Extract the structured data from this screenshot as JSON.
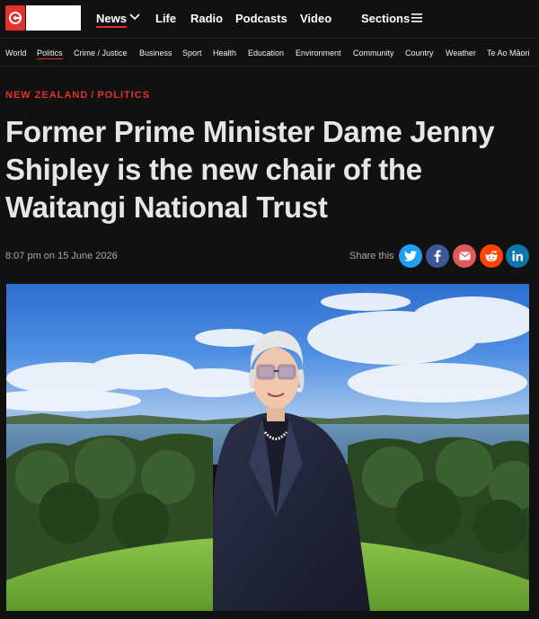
{
  "header": {
    "nav": [
      {
        "label": "News"
      },
      {
        "label": "Life"
      },
      {
        "label": "Radio"
      },
      {
        "label": "Podcasts"
      },
      {
        "label": "Video"
      }
    ],
    "sections_label": "Sections"
  },
  "subnav": {
    "items": [
      {
        "label": "World"
      },
      {
        "label": "Politics"
      },
      {
        "label": "Crime / Justice"
      },
      {
        "label": "Business"
      },
      {
        "label": "Sport"
      },
      {
        "label": "Health"
      },
      {
        "label": "Education"
      },
      {
        "label": "Environment"
      },
      {
        "label": "Community"
      },
      {
        "label": "Country"
      },
      {
        "label": "Weather"
      },
      {
        "label": "Te Ao Māori"
      }
    ],
    "active": "Politics"
  },
  "article": {
    "kicker_primary": "NEW ZEALAND",
    "kicker_separator": "/",
    "kicker_secondary": "POLITICS",
    "headline": "Former Prime Minister Dame Jenny Shipley is the new chair of the Waitangi National Trust",
    "timestamp": "8:07 pm on 15 June 2026",
    "share_label": "Share this"
  },
  "share_buttons": [
    {
      "icon": "twitter-icon",
      "color": "#1da1f2"
    },
    {
      "icon": "facebook-icon",
      "color": "#3b5998"
    },
    {
      "icon": "email-icon",
      "color": "#e05a5a"
    },
    {
      "icon": "reddit-icon",
      "color": "#ff4500"
    },
    {
      "icon": "linkedin-icon",
      "color": "#0e76a8"
    }
  ],
  "colors": {
    "accent": "#e2322b",
    "background": "#111111"
  }
}
